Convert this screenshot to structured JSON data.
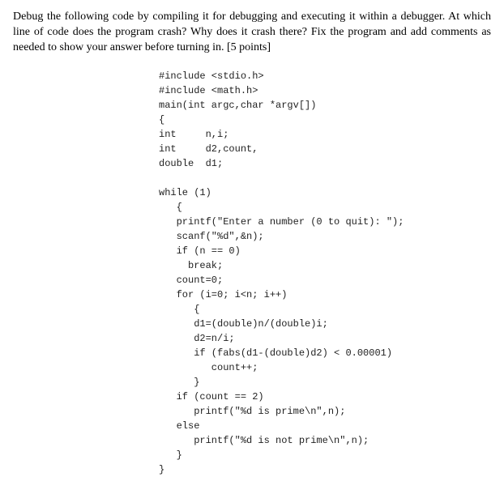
{
  "question": {
    "text": "Debug the following code by compiling it for debugging and executing it within a debugger. At which line of code does the program crash? Why does it crash there? Fix the program and add comments as needed to show your answer before turning in. [5 points]"
  },
  "code": {
    "lines": [
      "#include <stdio.h>",
      "#include <math.h>",
      "main(int argc,char *argv[])",
      "{",
      "int     n,i;",
      "int     d2,count,",
      "double  d1;",
      "",
      "while (1)",
      "   {",
      "   printf(\"Enter a number (0 to quit): \");",
      "   scanf(\"%d\",&n);",
      "   if (n == 0)",
      "     break;",
      "   count=0;",
      "   for (i=0; i<n; i++)",
      "      {",
      "      d1=(double)n/(double)i;",
      "      d2=n/i;",
      "      if (fabs(d1-(double)d2) < 0.00001)",
      "         count++;",
      "      }",
      "   if (count == 2)",
      "      printf(\"%d is prime\\n\",n);",
      "   else",
      "      printf(\"%d is not prime\\n\",n);",
      "   }",
      "}"
    ]
  }
}
